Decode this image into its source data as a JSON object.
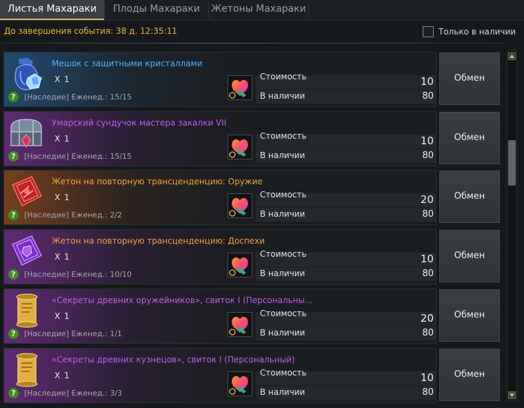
{
  "tabs": [
    {
      "label": "Листья Махараки"
    },
    {
      "label": "Плоды Махараки"
    },
    {
      "label": "Жетоны Махараки"
    }
  ],
  "timer": "До завершения события: 38 д. 12:35:11",
  "filter": {
    "label": "Только в наличии",
    "checked": false
  },
  "labels": {
    "cost": "Стоимость",
    "stock": "В наличии",
    "exchange": "Обмен",
    "help": "?"
  },
  "items": [
    {
      "name": "Мешок с защитными кристаллами",
      "qty": "X 1",
      "limit": "[Наследие] Еженед.: 15/15",
      "cost": "10",
      "stock": "80",
      "rarity_color": "#4fb5ff",
      "icon": "crystal-pouch-icon"
    },
    {
      "name": "Умарский сундучок мастера закалки VII",
      "qty": "X 1",
      "limit": "[Наследие] Еженед.: 15/15",
      "cost": "10",
      "stock": "80",
      "rarity_color": "#c35bf0",
      "icon": "treasure-chest-icon"
    },
    {
      "name": "Жетон на повторную трансценденцию: Оружие",
      "qty": "X 1",
      "limit": "[Наследие] Еженед.: 2/2",
      "cost": "20",
      "stock": "80",
      "rarity_color": "#f0a23a",
      "icon": "red-transcendence-token-icon"
    },
    {
      "name": "Жетон на повторную трансценденцию: Доспехи",
      "qty": "X 1",
      "limit": "[Наследие] Еженед.: 10/10",
      "cost": "10",
      "stock": "80",
      "rarity_color": "#f0a23a",
      "icon": "purple-transcendence-token-icon"
    },
    {
      "name": "«Секреты древних оружейников», свиток I (Персональны...",
      "qty": "X 1",
      "limit": "[Наследие] Еженед.: 1/1",
      "cost": "20",
      "stock": "80",
      "rarity_color": "#c35bf0",
      "icon": "scroll-icon"
    },
    {
      "name": "«Секреты древних кузнецов», свиток I (Персональный)",
      "qty": "X 1",
      "limit": "[Наследие] Еженед.: 3/3",
      "cost": "10",
      "stock": "80",
      "rarity_color": "#c35bf0",
      "icon": "scroll-icon"
    }
  ]
}
